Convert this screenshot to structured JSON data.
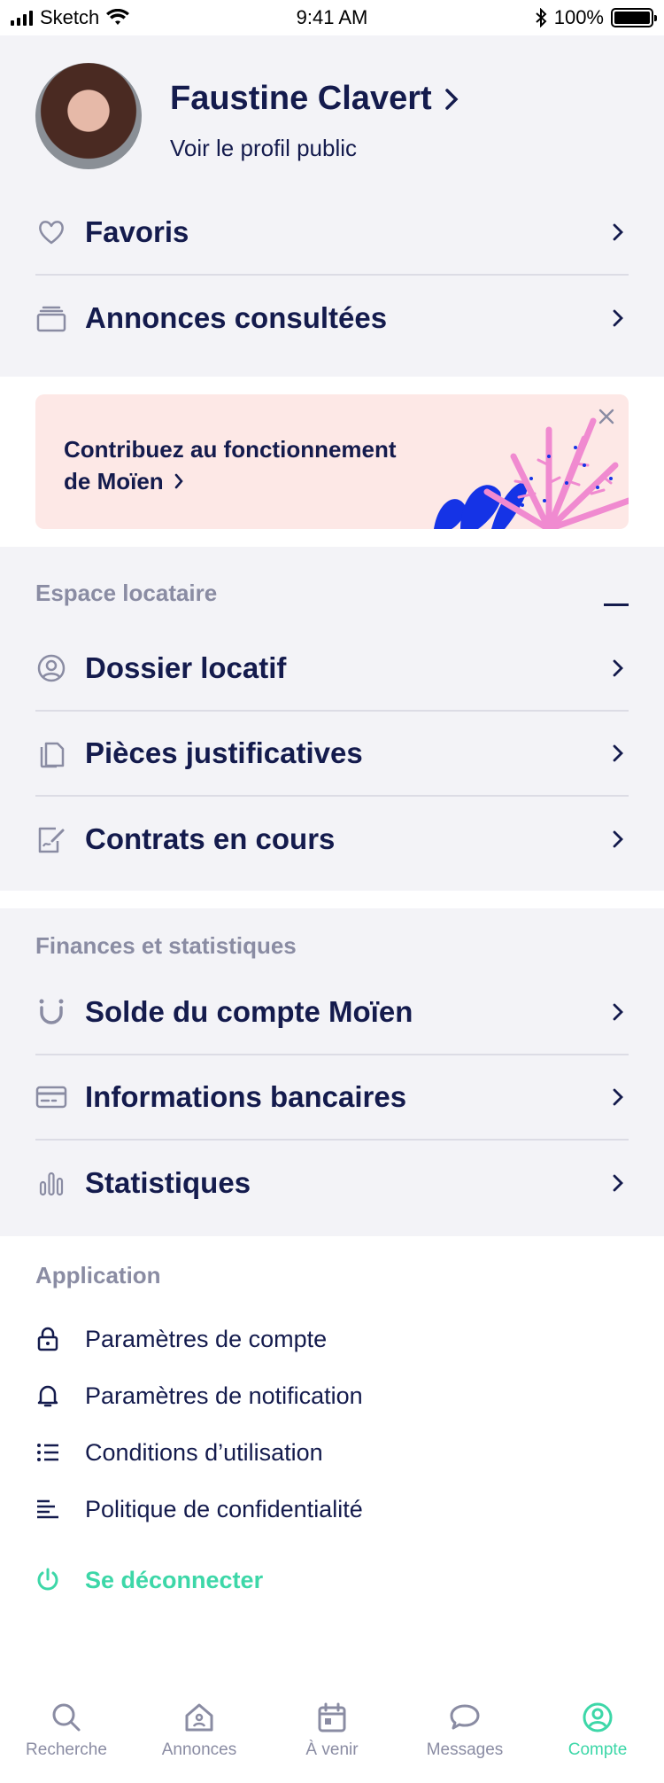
{
  "status_bar": {
    "carrier": "Sketch",
    "time": "9:41 AM",
    "battery": "100%"
  },
  "profile": {
    "name": "Faustine Clavert",
    "subtitle": "Voir le profil public"
  },
  "top_rows": [
    {
      "label": "Favoris",
      "icon": "heart-icon"
    },
    {
      "label": "Annonces consultées",
      "icon": "cards-stack-icon"
    }
  ],
  "banner": {
    "line1": "Contribuez au fonctionnement",
    "line2": "de Moïen",
    "colors": {
      "bg": "#fde8e6",
      "blue": "#1533e6",
      "pink": "#f08ad0"
    }
  },
  "espace": {
    "title": "Espace locataire",
    "rows": [
      {
        "label": "Dossier locatif",
        "icon": "user-circle-icon"
      },
      {
        "label": "Pièces justificatives",
        "icon": "documents-icon"
      },
      {
        "label": "Contrats en cours",
        "icon": "contract-sign-icon"
      }
    ]
  },
  "finances": {
    "title": "Finances et statistiques",
    "rows": [
      {
        "label": "Solde du compte Moïen",
        "icon": "moien-logo-icon"
      },
      {
        "label": "Informations bancaires",
        "icon": "credit-card-icon"
      },
      {
        "label": "Statistiques",
        "icon": "bar-chart-icon"
      }
    ]
  },
  "application": {
    "title": "Application",
    "rows": [
      {
        "label": "Paramètres de compte",
        "icon": "lock-icon"
      },
      {
        "label": "Paramètres de notification",
        "icon": "bell-icon"
      },
      {
        "label": "Conditions d’utilisation",
        "icon": "list-icon"
      },
      {
        "label": "Politique de confidentialité",
        "icon": "align-left-icon"
      }
    ],
    "logout": "Se déconnecter"
  },
  "tabs": [
    {
      "label": "Recherche",
      "icon": "search-icon",
      "active": false
    },
    {
      "label": "Annonces",
      "icon": "home-icon",
      "active": false
    },
    {
      "label": "À venir",
      "icon": "calendar-icon",
      "active": false
    },
    {
      "label": "Messages",
      "icon": "chat-icon",
      "active": false
    },
    {
      "label": "Compte",
      "icon": "account-icon",
      "active": true
    }
  ],
  "colors": {
    "text": "#141b4d",
    "muted": "#8a8ca3",
    "accent": "#3dd7a8",
    "grey_bg": "#f3f3f7"
  }
}
